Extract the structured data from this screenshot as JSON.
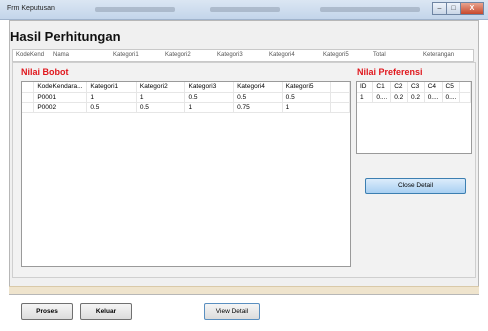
{
  "window": {
    "title": "Frm Keputusan",
    "minimize_label": "–",
    "maximize_label": "□",
    "close_label": "X"
  },
  "page_title": "Hasil Perhitungan",
  "header_strip": [
    "KodeKend",
    "Nama",
    "Kategori1",
    "Kategori2",
    "Kategori3",
    "Kategori4",
    "Kategori5",
    "Total",
    "Keterangan"
  ],
  "nilai_bobot": {
    "title": "Nilai Bobot",
    "columns": [
      "KodeKendara...",
      "Kategori1",
      "Kategori2",
      "Kategori3",
      "Kategori4",
      "Kategori5"
    ],
    "rows": [
      [
        "P0001",
        "1",
        "1",
        "0.5",
        "0.5",
        "0.5"
      ],
      [
        "P0002",
        "0.5",
        "0.5",
        "1",
        "0.75",
        "1"
      ]
    ]
  },
  "nilai_preferensi": {
    "title": "Nilai Preferensi",
    "columns": [
      "ID",
      "C1",
      "C2",
      "C3",
      "C4",
      "C5"
    ],
    "rows": [
      [
        "1",
        "0....",
        "0.2",
        "0.2",
        "0....",
        "0...."
      ]
    ]
  },
  "buttons": {
    "close_detail": "Close Detail",
    "proses": "Proses",
    "keluar": "Keluar",
    "view_detail": "View Detail"
  },
  "colors": {
    "section_title": "#e0171d",
    "accent_button": "#a9d0f2"
  }
}
